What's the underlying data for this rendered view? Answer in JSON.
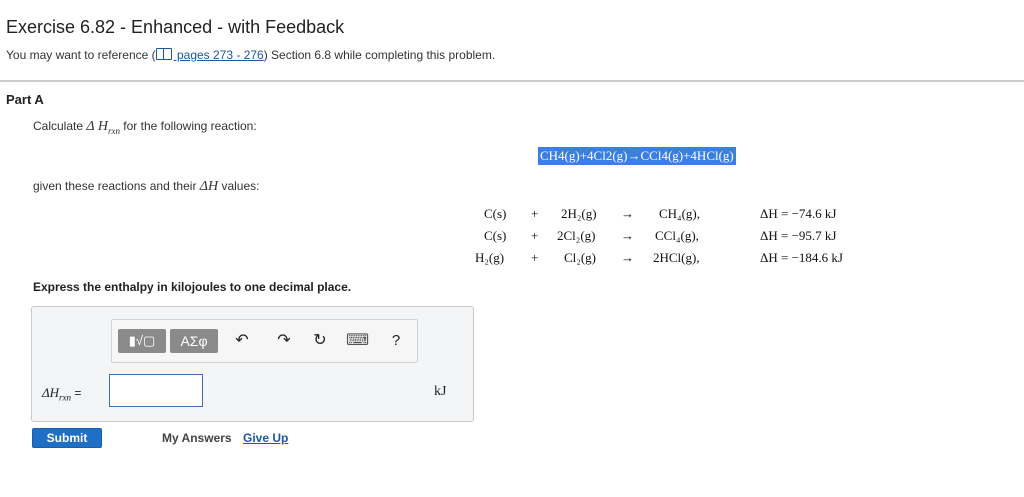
{
  "header": {
    "title": "Exercise 6.82 - Enhanced - with Feedback",
    "ref_prefix": "You may want to reference (",
    "ref_link": " pages 273 - 276",
    "ref_suffix": ") Section 6.8 while completing this problem."
  },
  "part": {
    "label": "Part A"
  },
  "question": {
    "calc_prefix": "Calculate ",
    "calc_symbol": "Δ H",
    "calc_sub": "rxn",
    "calc_suffix": " for the following reaction:",
    "target_reaction": "CH4(g)+4Cl2(g)→CCl4(g)+4HCl(g)",
    "given_prefix": "given these reactions and their ",
    "given_symbol": "ΔH",
    "given_suffix": " values:",
    "reactions": [
      {
        "r1": "C(s)",
        "plus": "+",
        "r2": "2H₂(g)",
        "arrow": "→",
        "product": "CH₄(g),",
        "dh": "ΔH = −74.6 kJ"
      },
      {
        "r1": "C(s)",
        "plus": "+",
        "r2": "2Cl₂(g)",
        "arrow": "→",
        "product": "CCl₄(g),",
        "dh": "ΔH = −95.7 kJ"
      },
      {
        "r1": "H₂(g)",
        "plus": "+",
        "r2": "Cl₂(g)",
        "arrow": "→",
        "product": "2HCl(g),",
        "dh": "ΔH = −184.6 kJ"
      }
    ],
    "instruction": "Express the enthalpy in kilojoules to one decimal place."
  },
  "answer": {
    "label_symbol": "ΔH",
    "label_sub": "rxn",
    "label_eq": " =",
    "value": "",
    "unit": "kJ"
  },
  "toolbar": {
    "templates_label": "▮√▢",
    "greek_label": "ΑΣφ",
    "undo_glyph": "↶",
    "redo_glyph": "↷",
    "reset_glyph": "↻",
    "keyboard_glyph": "⌨",
    "help_glyph": "?"
  },
  "actions": {
    "submit": "Submit",
    "my_answers": "My Answers",
    "give_up": "Give Up"
  }
}
